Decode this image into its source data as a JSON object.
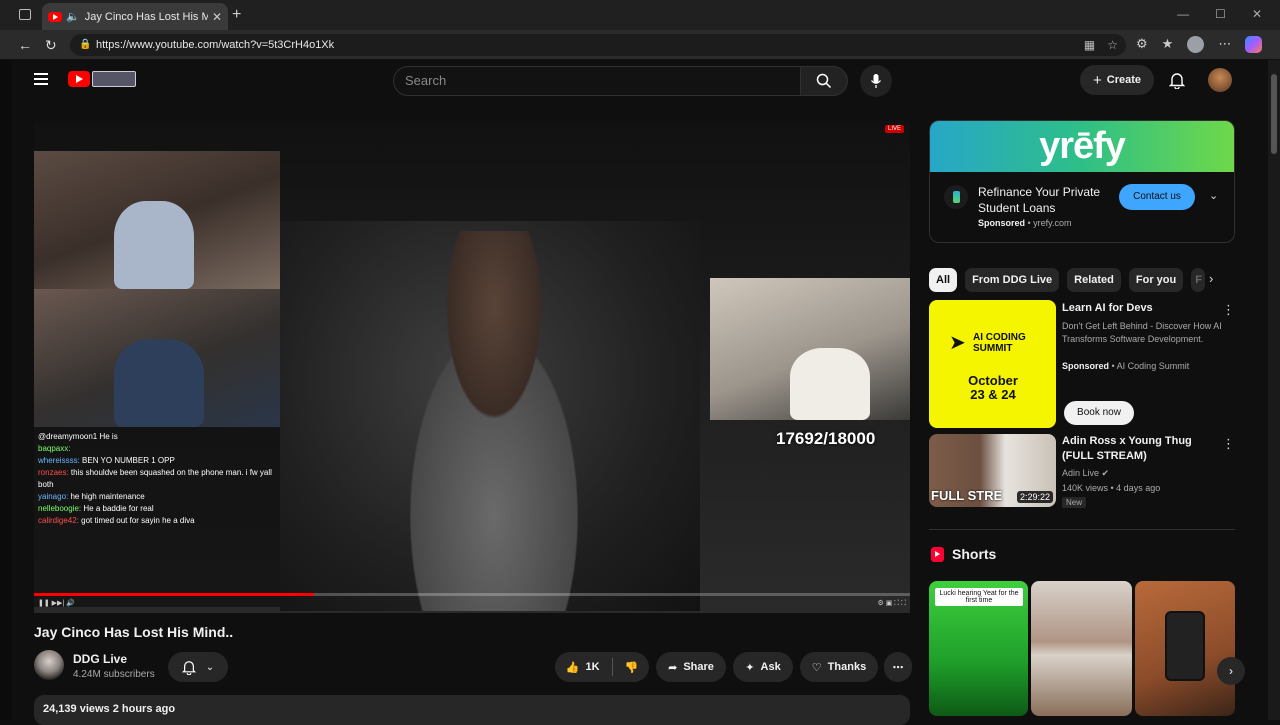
{
  "browser": {
    "tab_title": "Jay Cinco Has Lost His Mind",
    "url": "https://www.youtube.com/watch?v=5t3CrH4o1Xk"
  },
  "masthead": {
    "search_placeholder": "Search",
    "create_label": "Create"
  },
  "player": {
    "counter": "17692/18000",
    "progress_fraction": 0.32,
    "chat": [
      {
        "user": "",
        "msg": "@dreamymoon1 He is",
        "color": "r"
      },
      {
        "user": "baqpaxx:",
        "msg": "",
        "color": "g"
      },
      {
        "user": "whereissss:",
        "msg": "BEN YO NUMBER 1 OPP",
        "color": "b"
      },
      {
        "user": "ronzaes:",
        "msg": "this shouldve been squashed on the phone man. i fw yall both",
        "color": "r"
      },
      {
        "user": "yainago:",
        "msg": "he high maintenance",
        "color": "b"
      },
      {
        "user": "nelleboogie:",
        "msg": "He a baddie for real",
        "color": "g"
      },
      {
        "user": "calirdige42:",
        "msg": "got timed out for sayin he a diva",
        "color": "r"
      }
    ]
  },
  "video": {
    "title": "Jay Cinco Has Lost His Mind..",
    "channel": "DDG Live",
    "subscribers": "4.24M subscribers",
    "likes": "1K",
    "share_label": "Share",
    "ask_label": "Ask",
    "thanks_label": "Thanks",
    "views_date": "24,139 views  2 hours ago"
  },
  "ad": {
    "brand_banner": "yrēfy",
    "title": "Refinance Your Private Student Loans",
    "sponsored": "Sponsored",
    "domain": "yrefy.com",
    "cta": "Contact us"
  },
  "chips": [
    "All",
    "From DDG Live",
    "Related",
    "For you",
    "F"
  ],
  "recommendations": [
    {
      "thumb_line1": "AI CODING SUMMIT",
      "thumb_line2": "October 23 & 24",
      "title": "Learn AI for Devs",
      "desc": "Don't Get Left Behind - Discover How AI Transforms Software Development.",
      "sponsored": "Sponsored",
      "advertiser": "AI Coding Summit",
      "cta": "Book now"
    },
    {
      "thumb_caption": "FULL STRE",
      "duration": "2:29:22",
      "title": "Adin Ross x Young Thug (FULL STREAM)",
      "channel": "Adin Live",
      "meta": "140K views • 4 days ago",
      "badge": "New"
    }
  ],
  "shorts": {
    "header": "Shorts",
    "items": [
      {
        "caption": "Lucki hearing Yeat for the first time"
      },
      {
        "caption": ""
      },
      {
        "caption": ""
      }
    ]
  }
}
